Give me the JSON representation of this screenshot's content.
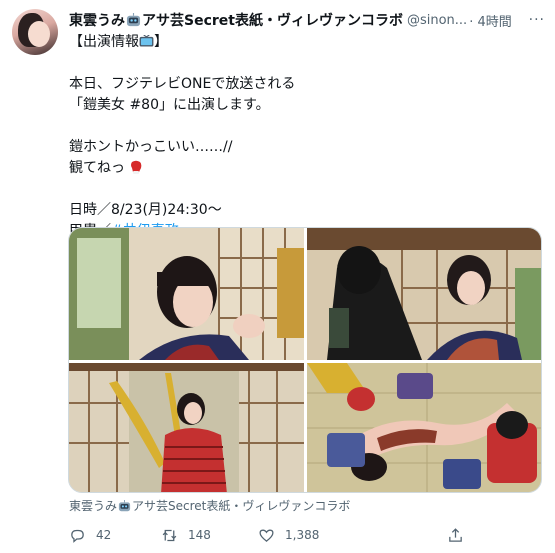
{
  "tweet": {
    "author_name": "東雲うみ",
    "author_name_suffix": "アサ芸Secret表紙・ヴィレヴァンコラボ",
    "handle": "@sinon...",
    "time": "4時間",
    "more_icon": "more-dots-icon",
    "lines": {
      "l1": "【出演情報",
      "l1_end": "】",
      "l2": "本日、フジテレビONEで放送される",
      "l3": "「鎧美女 #80」に出演します。",
      "l4": "鎧ホントかっこいい……//",
      "l5": "観てねっ",
      "l6": "日時／8/23(月)24:30〜",
      "l7_prefix": "甲冑／",
      "l7_hashtag": "#井伊直政"
    },
    "media_caption_name": "東雲うみ",
    "media_caption_suffix": "アサ芸Secret表紙・ヴィレヴァンコラボ",
    "media_count": 4
  },
  "actions": {
    "reply_count": "42",
    "retweet_count": "148",
    "like_count": "1,388",
    "reply_icon": "reply-icon",
    "retweet_icon": "retweet-icon",
    "like_icon": "heart-icon",
    "share_icon": "share-icon"
  },
  "colors": {
    "text": "#0f1419",
    "secondary": "#536471",
    "link": "#1d9bf0",
    "border": "#cfd9de"
  }
}
